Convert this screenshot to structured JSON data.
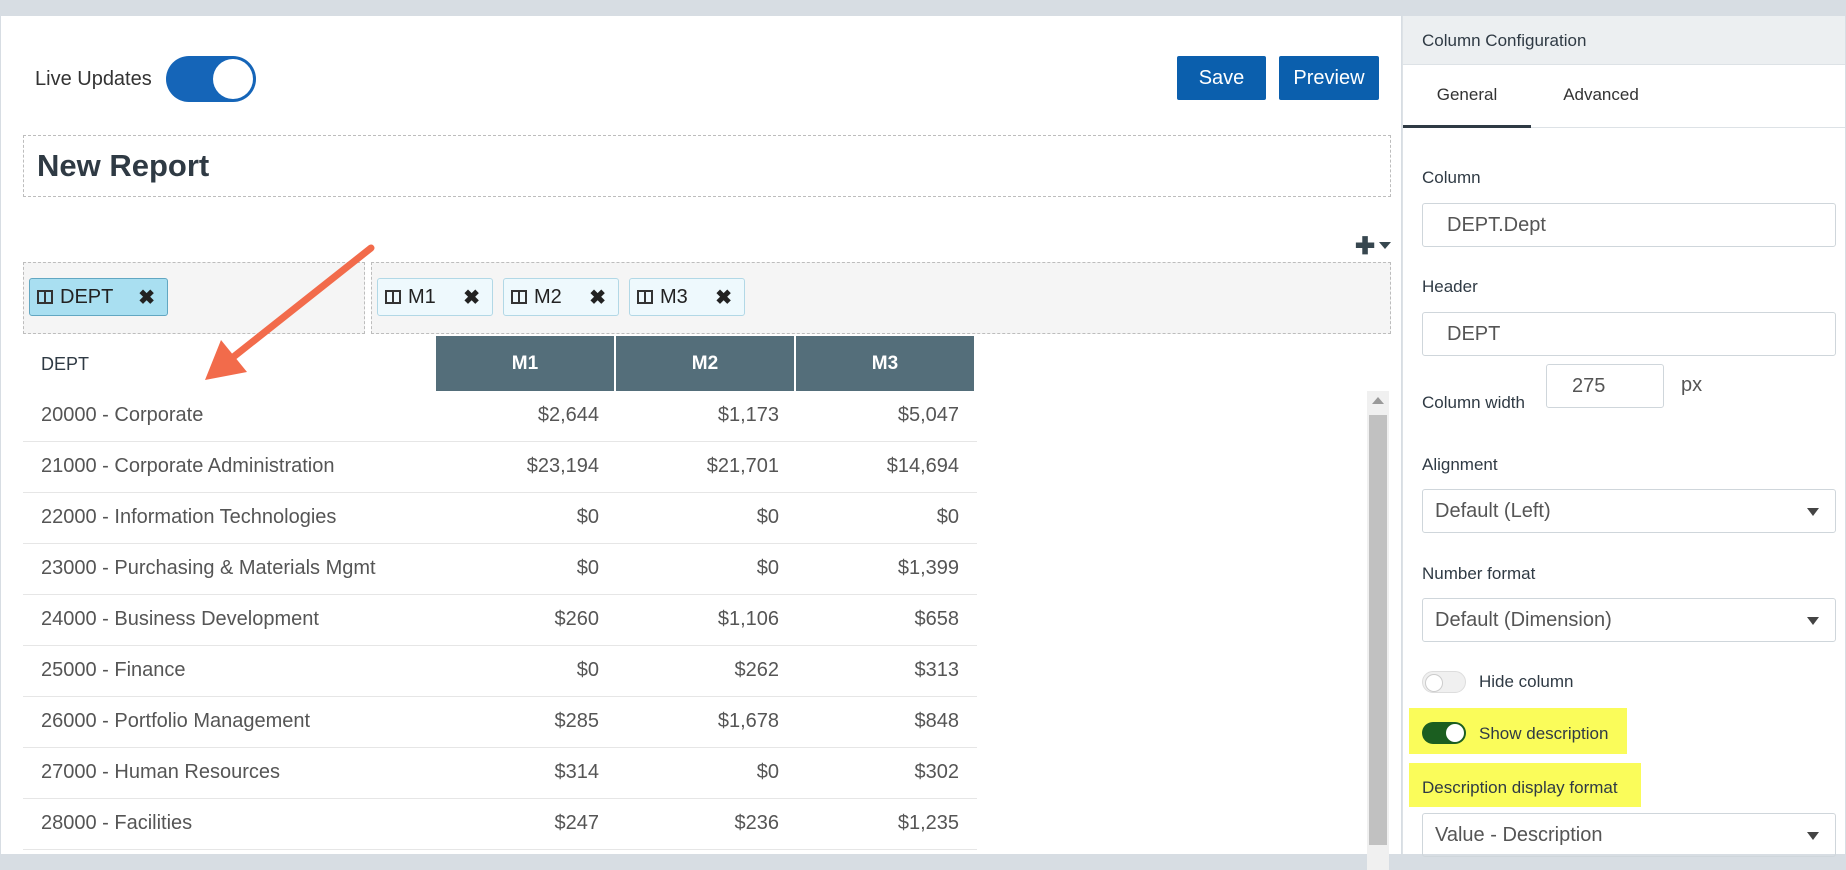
{
  "toolbar": {
    "live_updates_label": "Live Updates",
    "live_updates_on": true,
    "save_label": "Save",
    "preview_label": "Preview"
  },
  "report": {
    "title": "New Report"
  },
  "pivot": {
    "row_chips": [
      {
        "label": "DEPT"
      }
    ],
    "column_chips": [
      {
        "label": "M1"
      },
      {
        "label": "M2"
      },
      {
        "label": "M3"
      }
    ]
  },
  "table": {
    "dept_header": "DEPT",
    "headers": [
      "M1",
      "M2",
      "M3"
    ],
    "rows": [
      {
        "dept": "20000 - Corporate",
        "m1": "$2,644",
        "m2": "$1,173",
        "m3": "$5,047"
      },
      {
        "dept": "21000 - Corporate Administration",
        "m1": "$23,194",
        "m2": "$21,701",
        "m3": "$14,694"
      },
      {
        "dept": "22000 - Information Technologies",
        "m1": "$0",
        "m2": "$0",
        "m3": "$0"
      },
      {
        "dept": "23000 - Purchasing & Materials Mgmt",
        "m1": "$0",
        "m2": "$0",
        "m3": "$1,399"
      },
      {
        "dept": "24000 - Business Development",
        "m1": "$260",
        "m2": "$1,106",
        "m3": "$658"
      },
      {
        "dept": "25000 - Finance",
        "m1": "$0",
        "m2": "$262",
        "m3": "$313"
      },
      {
        "dept": "26000 - Portfolio Management",
        "m1": "$285",
        "m2": "$1,678",
        "m3": "$848"
      },
      {
        "dept": "27000 - Human Resources",
        "m1": "$314",
        "m2": "$0",
        "m3": "$302"
      },
      {
        "dept": "28000 - Facilities",
        "m1": "$247",
        "m2": "$236",
        "m3": "$1,235"
      }
    ]
  },
  "panel": {
    "title": "Column Configuration",
    "tabs": [
      "General",
      "Advanced"
    ],
    "column_label": "Column",
    "column_value": "DEPT.Dept",
    "header_label": "Header",
    "header_value": "DEPT",
    "width_label": "Column width",
    "width_value": "275",
    "width_unit": "px",
    "alignment_label": "Alignment",
    "alignment_value": "Default (Left)",
    "number_format_label": "Number format",
    "number_format_value": "Default (Dimension)",
    "hide_column_label": "Hide column",
    "hide_column_on": false,
    "show_description_label": "Show description",
    "show_description_on": true,
    "desc_format_label": "Description display format",
    "desc_format_value": "Value - Description"
  },
  "colors": {
    "primary_button": "#0b5fad",
    "toggle_on": "#1565b8",
    "table_header": "#546e7a",
    "chip_active": "#a9dff1",
    "highlight": "#fafc5a",
    "annotation_arrow": "#f26b4b"
  }
}
